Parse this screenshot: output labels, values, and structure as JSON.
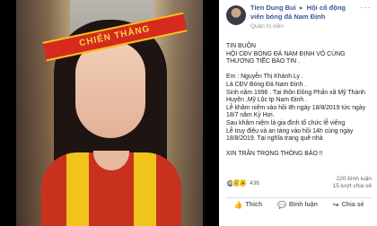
{
  "photo": {
    "banner_text": "CHIẾN THẮNG"
  },
  "post": {
    "author": "Tien Dung Bui",
    "arrow": "▸",
    "group": "Hội cổ động viên bóng đá Nam Định",
    "subtitle": "Quản trị viên",
    "menu": "···",
    "lines": [
      "TIN BUỒN",
      "HỘI CĐV BÓNG ĐÁ NAM ĐỊNH VÔ CÙNG THƯƠNG TIẾC BÁO TIN .",
      "",
      "Em : Nguyễn Thị Khánh Ly .",
      "Là CĐV Bóng Đá Nam Định .",
      "Sinh năm 1996 . Tại thôn Đồng Phấn xã Mỹ Thành Huyện ,Mỹ Lộc tp Nam Định .",
      "Lễ khâm niệm vào hồi 8h ngày 18/8/2019 tức ngày 18/7 năm Kỷ Hợi.",
      "Sau khâm niệm là gia đình tổ chức lễ viếng",
      "Lễ truy điệu và an táng vào hồi 14h cùng ngày 18/8/2019. Tại nghĩa trang quê nhà",
      "",
      "XIN TRÂN TRỌNG THÔNG BÁO !!"
    ]
  },
  "stats": {
    "reaction_count": "436",
    "comments": "220 bình luận",
    "shares": "15 lượt chia sẻ"
  },
  "actions": {
    "like": "Thích",
    "comment": "Bình luận",
    "share": "Chia sẻ"
  },
  "colors": {
    "link": "#385898",
    "muted": "#90949c",
    "panel": "#000000"
  }
}
